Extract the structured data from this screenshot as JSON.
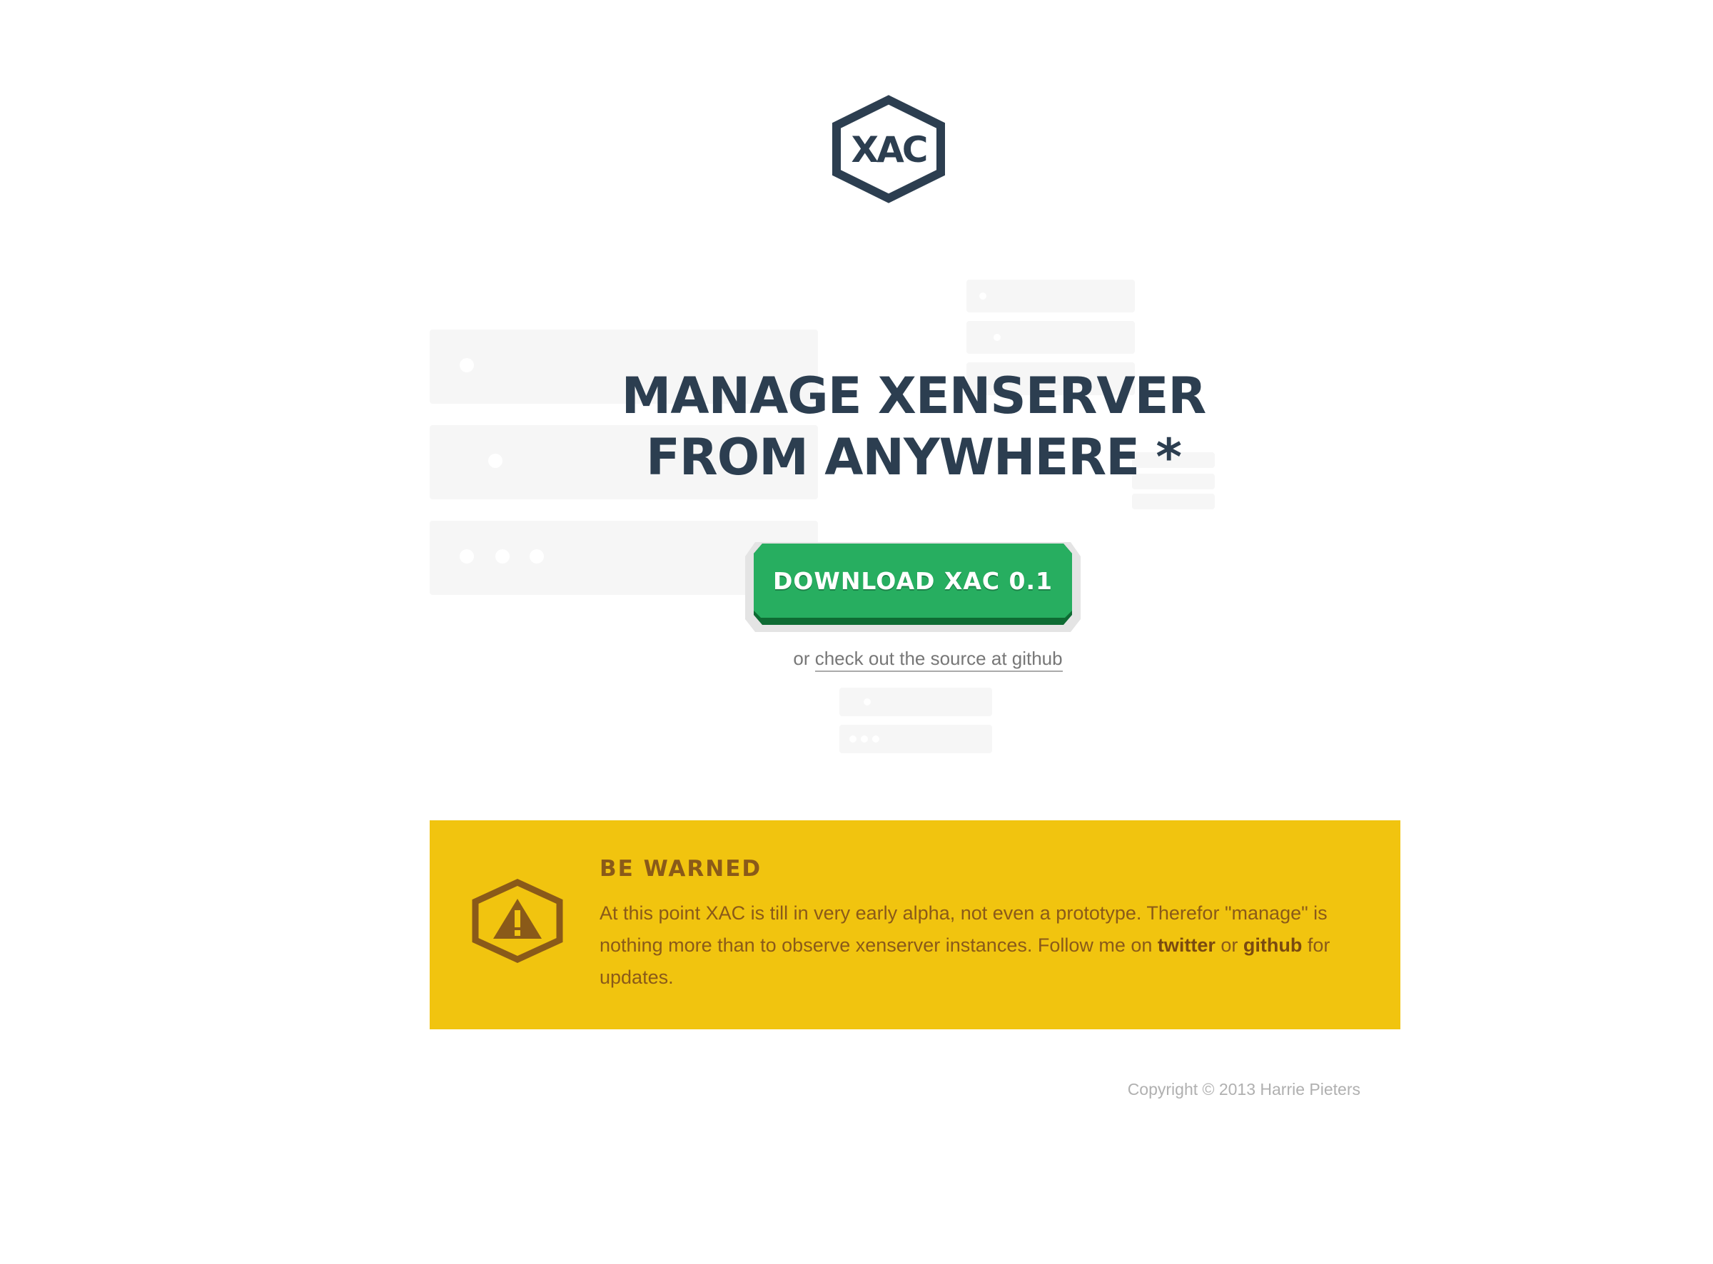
{
  "brand": {
    "logo_text": "XAC",
    "color": "#2c3e50"
  },
  "hero": {
    "headline_line1": "MANAGE XENSERVER",
    "headline_line2": "FROM ANYWHERE *",
    "download_button_label": "DOWNLOAD XAC 0.1",
    "source_prefix": "or ",
    "source_link_label": "check out the source at github",
    "button_color": "#27ae60"
  },
  "warning": {
    "icon": "warning-hexagon-icon",
    "title": "BE WARNED",
    "text_part1": "At this point XAC is till in very early alpha, not even a prototype. Therefor \"manage\" is nothing more than to observe xenserver instances. Follow me on ",
    "twitter_label": "twitter",
    "text_part2": " or ",
    "github_label": "github",
    "text_part3": " for updates.",
    "background_color": "#f1c40f",
    "text_color": "#8a5a19"
  },
  "footer": {
    "copyright": "Copyright © 2013 Harrie Pieters"
  }
}
